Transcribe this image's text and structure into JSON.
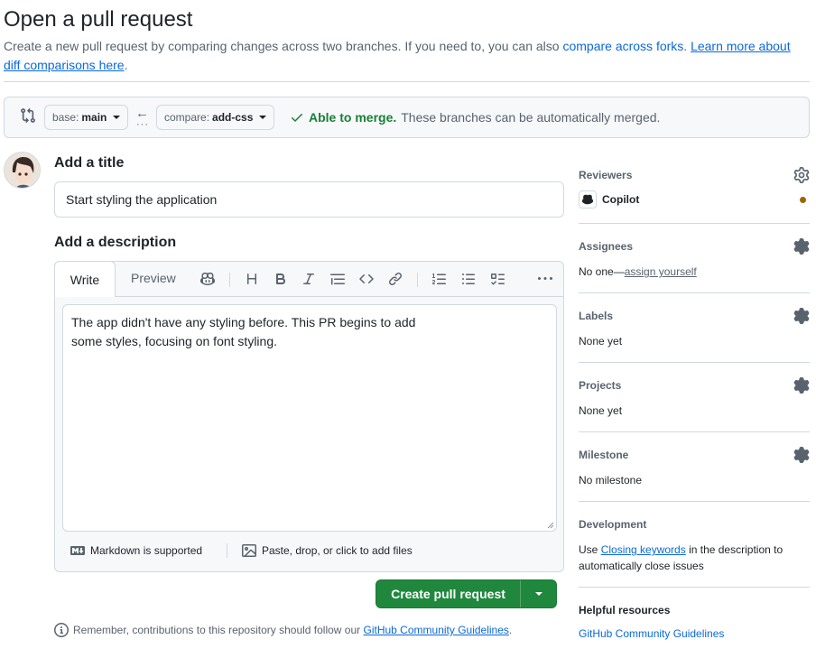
{
  "page": {
    "title": "Open a pull request",
    "subtitle_text": "Create a new pull request by comparing changes across two branches. If you need to, you can also ",
    "compare_forks_link": "compare across forks",
    "subtitle_sep": ". ",
    "learn_more_link": "Learn more about diff comparisons here",
    "subtitle_end": "."
  },
  "range": {
    "base_prefix": "base: ",
    "base_branch": "main",
    "compare_prefix": "compare: ",
    "compare_branch": "add-css",
    "merge_ok": "Able to merge.",
    "merge_msg": "These branches can be automatically merged."
  },
  "form": {
    "title_label": "Add a title",
    "title_value": "Start styling the application",
    "desc_label": "Add a description",
    "tab_write": "Write",
    "tab_preview": "Preview",
    "desc_value": "The app didn't have any styling before. This PR begins to add\nsome styles, focusing on font styling.",
    "markdown_note": "Markdown is supported",
    "attach_note": "Paste, drop, or click to add files",
    "create_button": "Create pull request",
    "remember_text": "Remember, contributions to this repository should follow our ",
    "guidelines_link": "GitHub Community Guidelines",
    "remember_end": "."
  },
  "sidebar": {
    "reviewers": {
      "title": "Reviewers",
      "value": "Copilot",
      "status_color": "#9a6700"
    },
    "assignees": {
      "title": "Assignees",
      "value_prefix": "No one—",
      "assign_link": "assign yourself"
    },
    "labels": {
      "title": "Labels",
      "value": "None yet"
    },
    "projects": {
      "title": "Projects",
      "value": "None yet"
    },
    "milestone": {
      "title": "Milestone",
      "value": "No milestone"
    },
    "development": {
      "title": "Development",
      "value_prefix": "Use ",
      "keywords_link": "Closing keywords",
      "value_suffix": " in the description to automatically close issues"
    },
    "resources": {
      "title": "Helpful resources",
      "link": "GitHub Community Guidelines"
    }
  },
  "colors": {
    "primary_button": "#1f883d",
    "link": "#0969da",
    "success": "#1a7f37"
  }
}
